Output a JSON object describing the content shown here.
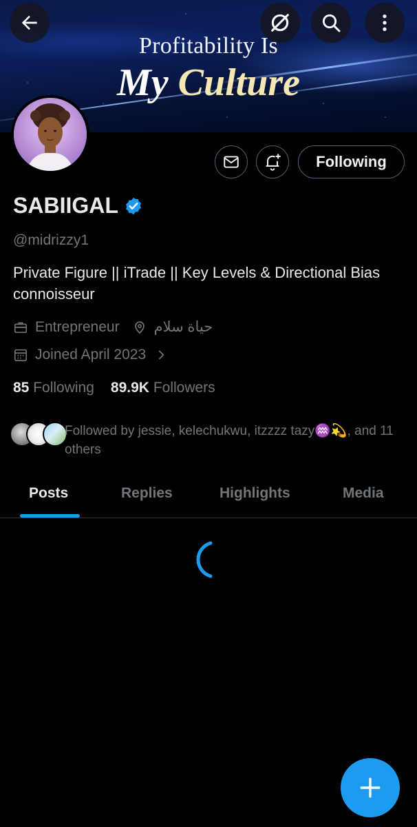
{
  "banner": {
    "line1": "Profitability Is",
    "line2_a": "My ",
    "line2_b": "Culture"
  },
  "top_bar": {
    "back_icon": "arrow-left-icon",
    "grok_icon": "slashed-circle-icon",
    "search_icon": "search-icon",
    "more_icon": "more-vertical-icon"
  },
  "profile": {
    "display_name": "SABIIGAL",
    "verified": true,
    "handle": "@midrizzy1",
    "bio": "Private Figure || iTrade || Key Levels & Directional Bias connoisseur",
    "profession": "Entrepreneur",
    "location": "حياة سلام",
    "joined": "Joined April 2023",
    "following_count": "85",
    "following_label": "Following",
    "followers_count": "89.9K",
    "followers_label": "Followers",
    "followed_by": "Followed by jessie, kelechukwu, itzzzz tazy♒💫, and 11 others"
  },
  "actions": {
    "message_icon": "envelope-icon",
    "notify_icon": "bell-plus-icon",
    "following_button": "Following"
  },
  "tabs": [
    "Posts",
    "Replies",
    "Highlights",
    "Media"
  ],
  "active_tab": "Posts",
  "fab": {
    "icon": "plus-icon"
  },
  "colors": {
    "accent": "#1d9bf0",
    "background": "#000000",
    "secondary_text": "#71767b",
    "primary_text": "#e7e9ea"
  }
}
